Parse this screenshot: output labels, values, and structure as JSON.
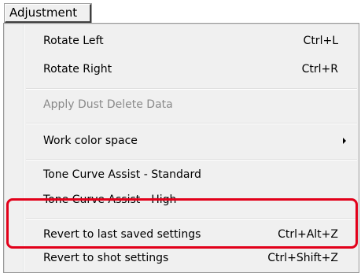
{
  "menubar": {
    "active_menu": "Adjustment"
  },
  "menu": {
    "items": [
      {
        "label": "Rotate Left",
        "shortcut": "Ctrl+L"
      },
      {
        "label": "Rotate Right",
        "shortcut": "Ctrl+R"
      },
      {
        "label": "Apply Dust Delete Data",
        "shortcut": "",
        "disabled": true
      },
      {
        "label": "Work color space",
        "shortcut": "",
        "submenu": true
      },
      {
        "label": "Tone Curve Assist - Standard",
        "shortcut": ""
      },
      {
        "label": "Tone Curve Assist - High",
        "shortcut": ""
      },
      {
        "label": "Revert to last saved settings",
        "shortcut": "Ctrl+Alt+Z"
      },
      {
        "label": "Revert to shot settings",
        "shortcut": "Ctrl+Shift+Z"
      }
    ]
  },
  "colors": {
    "menu_background": "#f0f0f0",
    "disabled_text": "#8a8a8a",
    "highlight_box": "#e2001a"
  }
}
